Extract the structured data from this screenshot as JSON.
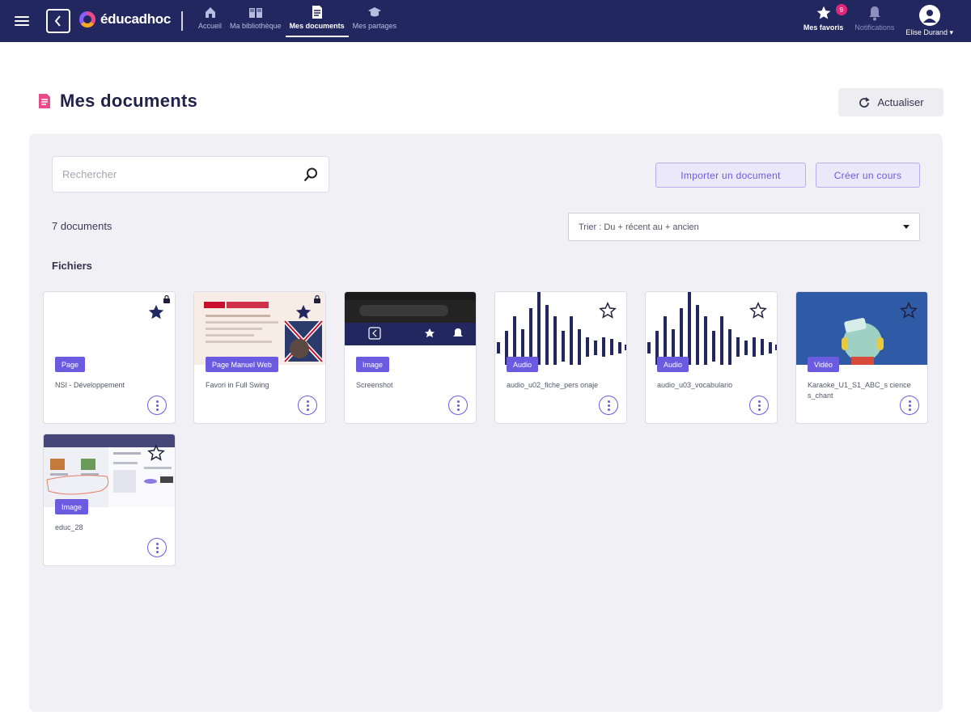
{
  "topbar": {
    "logo_text": "éducadhoc",
    "nav": [
      {
        "label": "Accueil",
        "icon": "home-icon"
      },
      {
        "label": "Ma bibliothèque",
        "icon": "library-icon"
      },
      {
        "label": "Mes documents",
        "icon": "document-icon"
      },
      {
        "label": "Mes partages",
        "icon": "graduation-cap-icon"
      }
    ],
    "favorites_label": "Mes favoris",
    "favorites_badge": "9",
    "notifications_label": "Notifications",
    "user_name": "Elise Durand"
  },
  "page": {
    "title": "Mes documents",
    "refresh_label": "Actualiser"
  },
  "toolbar": {
    "search_placeholder": "Rechercher",
    "import_label": "Importer un document",
    "create_label": "Créer un cours",
    "count_label": "7 documents",
    "sort_label": "Trier : Du + récent au + ancien"
  },
  "section_label": "Fichiers",
  "cards": [
    {
      "type": "Page",
      "name": "NSI - Développement",
      "favorite": true
    },
    {
      "type": "Page Manuel Web",
      "name": "Favori in Full Swing",
      "favorite": true
    },
    {
      "type": "Image",
      "name": "Screenshot",
      "favorite": false
    },
    {
      "type": "Audio",
      "name": "audio_u02_fiche_pers onaje",
      "favorite": false
    },
    {
      "type": "Audio",
      "name": "audio_u03_vocabulario",
      "favorite": false
    },
    {
      "type": "Vidéo",
      "name": "Karaoke_U1_S1_ABC_s ciences_chant",
      "favorite": false
    },
    {
      "type": "Image",
      "name": "educ_28",
      "favorite": false
    }
  ],
  "colors": {
    "topbar": "#232760",
    "accent": "#6b5be0",
    "badge": "#e2277a",
    "panel": "#f0f0f5"
  }
}
